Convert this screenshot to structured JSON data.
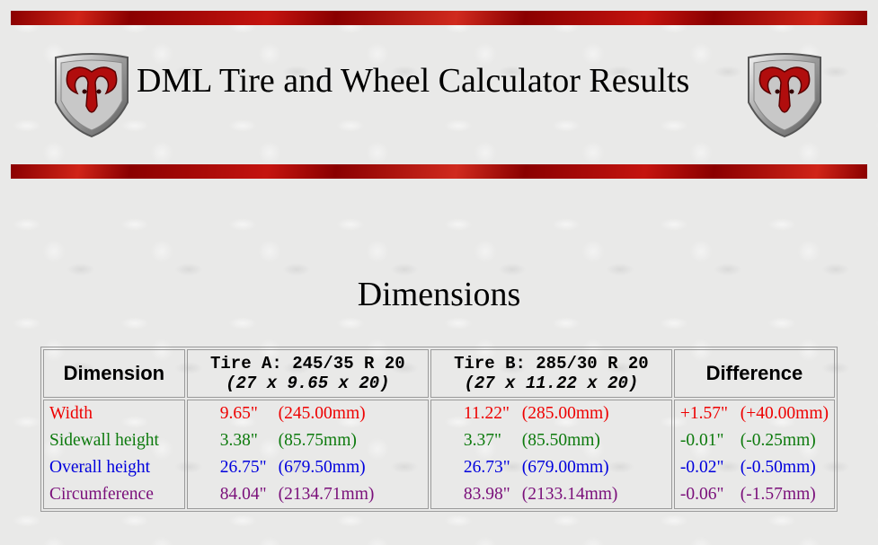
{
  "header": {
    "title": "DML Tire and Wheel Calculator Results"
  },
  "section": {
    "title": "Dimensions"
  },
  "table": {
    "headers": {
      "dimension": "Dimension",
      "tire_a_main": "Tire A: 245/35 R 20",
      "tire_a_sub": "(27 x 9.65 x 20)",
      "tire_b_main": "Tire B: 285/30 R 20",
      "tire_b_sub": "(27 x 11.22 x 20)",
      "difference": "Difference"
    },
    "rows": [
      {
        "label": "Width",
        "a_in": "9.65\"",
        "a_mm": "(245.00mm)",
        "b_in": "11.22\"",
        "b_mm": "(285.00mm)",
        "d_in": "+1.57\"",
        "d_mm": "(+40.00mm)"
      },
      {
        "label": "Sidewall height",
        "a_in": "3.38\"",
        "a_mm": "(85.75mm)",
        "b_in": "3.37\"",
        "b_mm": "(85.50mm)",
        "d_in": "-0.01\"",
        "d_mm": "(-0.25mm)"
      },
      {
        "label": "Overall height",
        "a_in": "26.75\"",
        "a_mm": "(679.50mm)",
        "b_in": "26.73\"",
        "b_mm": "(679.00mm)",
        "d_in": "-0.02\"",
        "d_mm": "(-0.50mm)"
      },
      {
        "label": "Circumference",
        "a_in": "84.04\"",
        "a_mm": "(2134.71mm)",
        "b_in": "83.98\"",
        "b_mm": "(2133.14mm)",
        "d_in": "-0.06\"",
        "d_mm": "(-1.57mm)"
      }
    ]
  },
  "colors": {
    "width": "#ee0000",
    "sidewall": "#0d7a0d",
    "overall": "#0000dd",
    "circumference": "#7a0f7a",
    "banner": "#8a0000"
  },
  "icons": {
    "logo": "ram-head-shield-logo"
  }
}
